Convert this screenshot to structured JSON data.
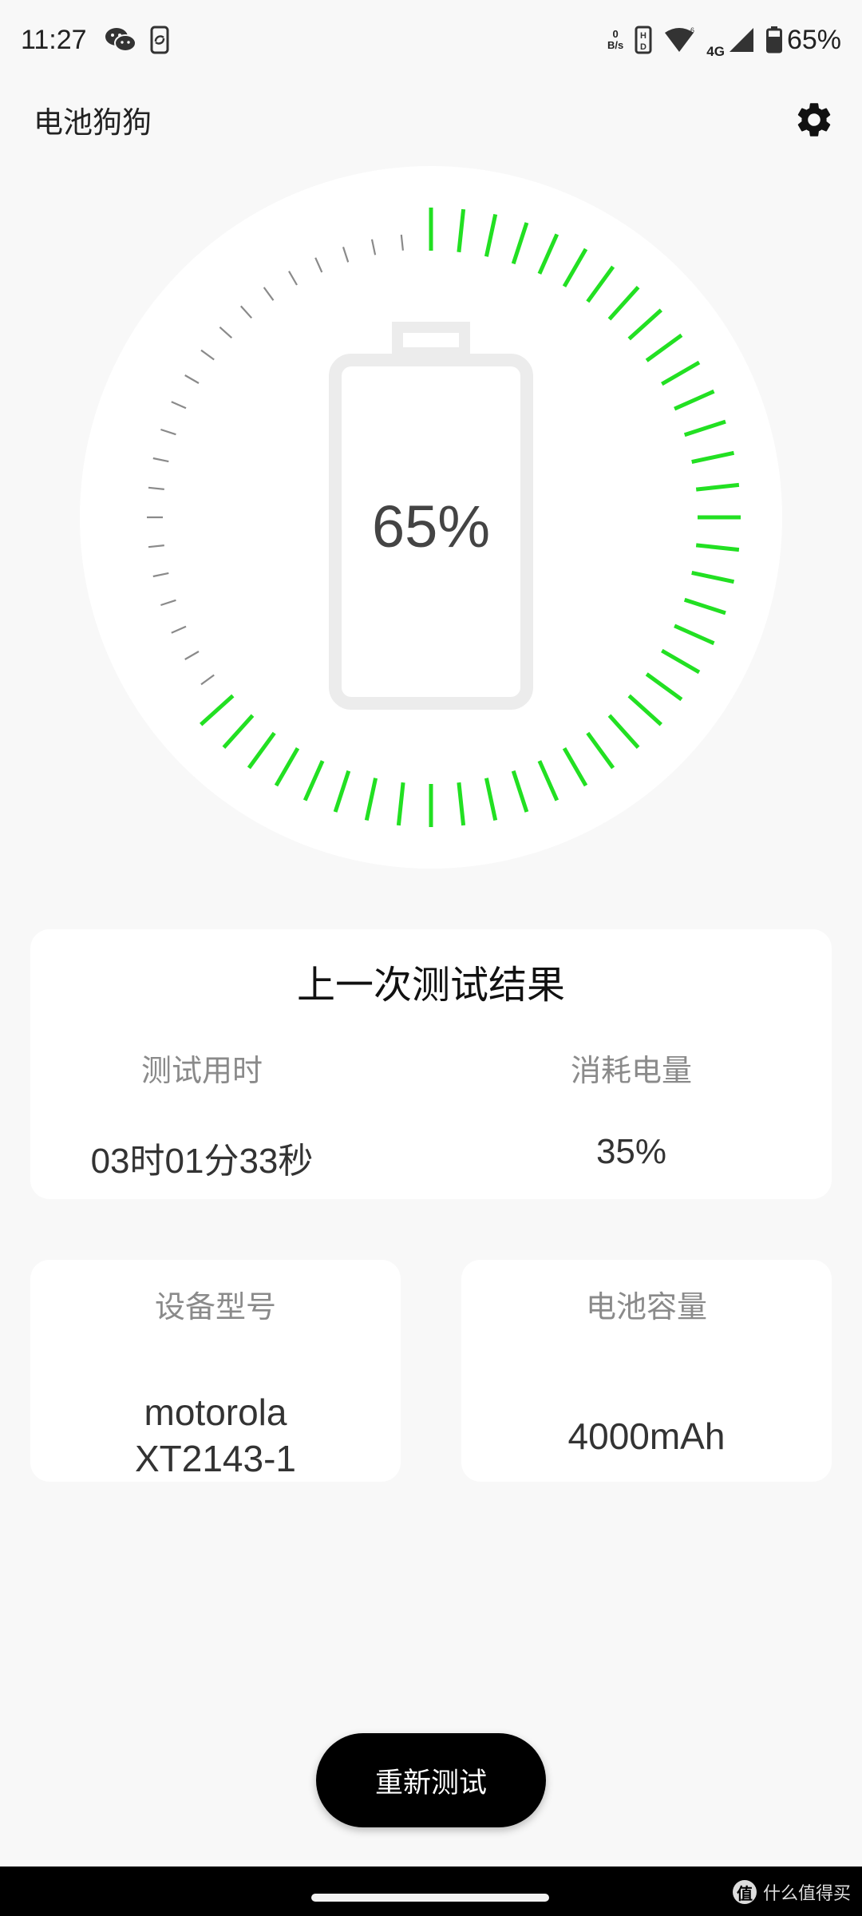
{
  "status_bar": {
    "time": "11:27",
    "net_speed_value": "0",
    "net_speed_unit": "B/s",
    "network_type": "4G",
    "battery_percent": "65%"
  },
  "app_bar": {
    "title": "电池狗狗",
    "settings_icon": "gear-icon"
  },
  "gauge": {
    "percent_label": "65%",
    "level": 0.65,
    "tick_count": 60,
    "active_color": "#22e022",
    "inactive_color": "#8a8a8a"
  },
  "last_result": {
    "title": "上一次测试结果",
    "duration_label": "测试用时",
    "duration_value": "03时01分33秒",
    "consumed_label": "消耗电量",
    "consumed_value": "35%"
  },
  "device": {
    "label": "设备型号",
    "value_line1": "motorola",
    "value_line2": "XT2143-1"
  },
  "capacity": {
    "label": "电池容量",
    "value": "4000mAh"
  },
  "retest_button": {
    "label": "重新测试"
  },
  "watermark": {
    "logo_char": "值",
    "text": "什么值得买"
  }
}
